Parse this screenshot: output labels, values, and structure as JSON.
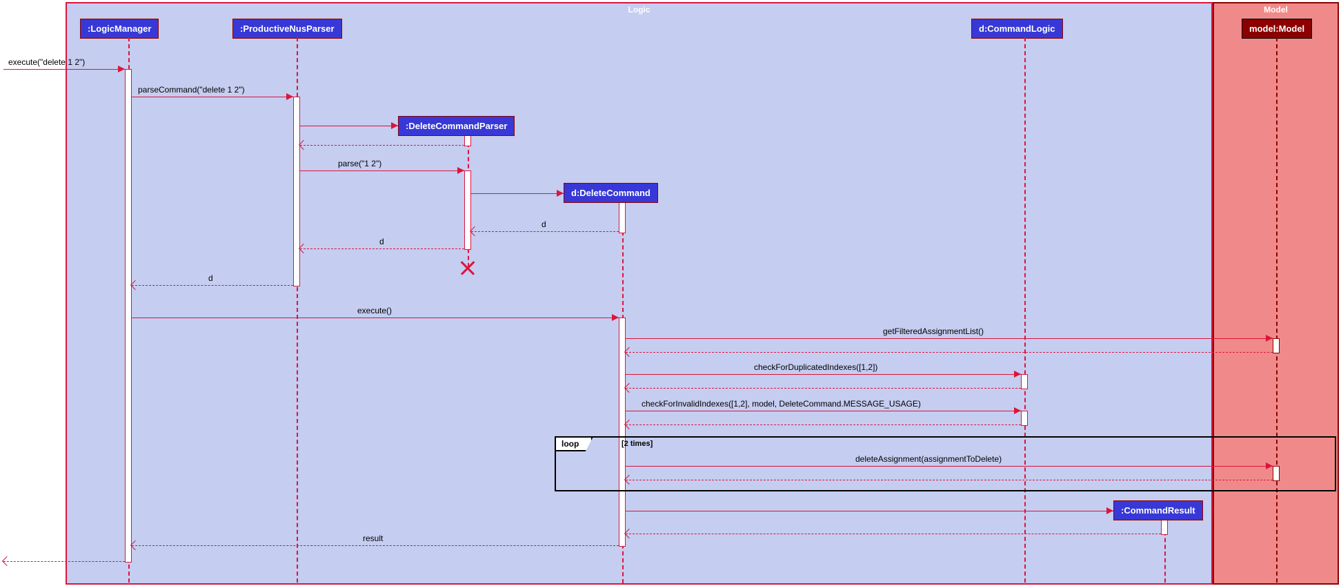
{
  "frames": {
    "logic": {
      "label": "Logic",
      "bg": "#c5cdf0",
      "border": "#dc143c"
    },
    "model": {
      "label": "Model",
      "bg": "#f08a8a",
      "border": "#8b0000"
    }
  },
  "participants": {
    "logicManager": {
      "label": ":LogicManager",
      "bg": "#3838d6",
      "fg": "#ffffff",
      "border": "#8b0000"
    },
    "parser": {
      "label": ":ProductiveNusParser",
      "bg": "#3838d6",
      "fg": "#ffffff",
      "border": "#8b0000"
    },
    "deleteParser": {
      "label": ":DeleteCommandParser",
      "bg": "#3838d6",
      "fg": "#ffffff",
      "border": "#8b0000"
    },
    "deleteCommand": {
      "label": "d:DeleteCommand",
      "bg": "#3838d6",
      "fg": "#ffffff",
      "border": "#8b0000"
    },
    "commandLogic": {
      "label": "d:CommandLogic",
      "bg": "#3838d6",
      "fg": "#ffffff",
      "border": "#8b0000"
    },
    "commandResult": {
      "label": ":CommandResult",
      "bg": "#3838d6",
      "fg": "#ffffff",
      "border": "#8b0000"
    },
    "model": {
      "label": "model:Model",
      "bg": "#8b0000",
      "fg": "#ffffff",
      "border": "#000000"
    }
  },
  "messages": {
    "m1": "execute(\"delete 1 2\")",
    "m2": "parseCommand(\"delete 1 2\")",
    "m3": "parse(\"1 2\")",
    "m4": "d",
    "m5": "d",
    "m6": "d",
    "m7": "execute()",
    "m8": "getFilteredAssignmentList()",
    "m9": "checkForDuplicatedIndexes([1,2])",
    "m10": "checkForInvalidIndexes([1,2], model, DeleteCommand.MESSAGE_USAGE)",
    "m11": "deleteAssignment(assignmentToDelete)",
    "m12": "result"
  },
  "loop": {
    "label": "loop",
    "guard": "[2 times]"
  },
  "colors": {
    "logicLine": "#dc143c",
    "modelLine": "#8b0000",
    "text": "#000000"
  }
}
